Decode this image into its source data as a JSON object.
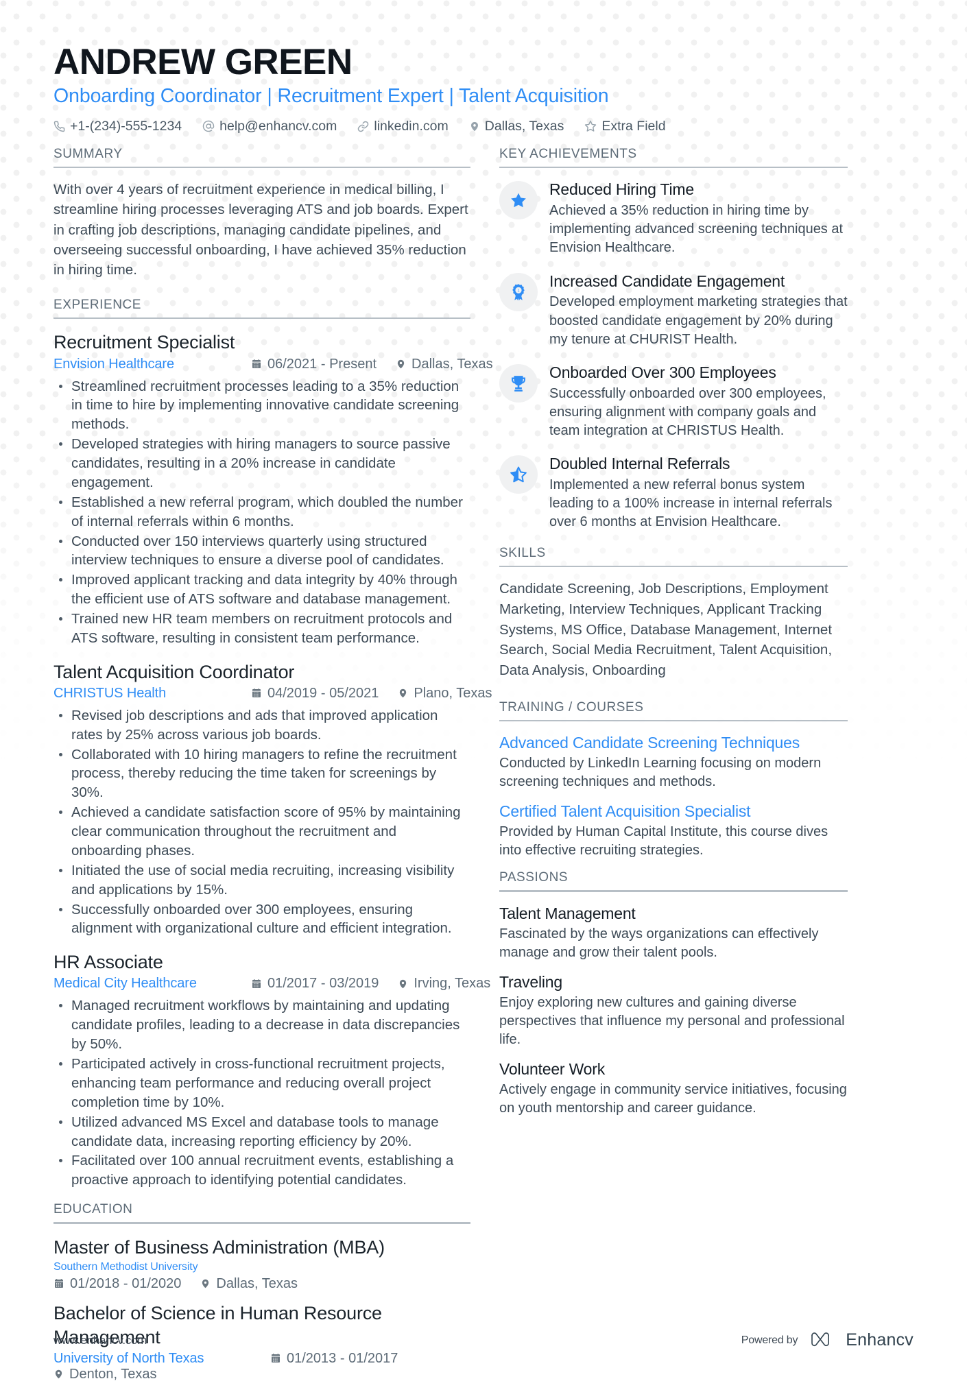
{
  "theme": {
    "accent": "#2f8df5",
    "text": "#3d4a56",
    "heading": "#141c24",
    "rule": "#b7bfc6",
    "icon_chip_bg": "#f0f1f2"
  },
  "header": {
    "name": "ANDREW GREEN",
    "headline": "Onboarding Coordinator | Recruitment Expert | Talent Acquisition",
    "contacts": [
      {
        "icon": "phone-icon",
        "label": "+1-(234)-555-1234"
      },
      {
        "icon": "at-sign-icon",
        "label": "help@enhancv.com"
      },
      {
        "icon": "link-icon",
        "label": "linkedin.com"
      },
      {
        "icon": "map-pin-icon",
        "label": "Dallas, Texas"
      },
      {
        "icon": "star-outline-icon",
        "label": "Extra Field"
      }
    ]
  },
  "left": {
    "summary": {
      "title": "SUMMARY",
      "text": "With over 4 years of recruitment experience in medical billing, I streamline hiring processes leveraging ATS and job boards. Expert in crafting job descriptions, managing candidate pipelines, and overseeing successful onboarding, I have achieved 35% reduction in hiring time."
    },
    "experience": {
      "title": "EXPERIENCE",
      "jobs": [
        {
          "title": "Recruitment Specialist",
          "company": "Envision Healthcare",
          "dates": "06/2021 - Present",
          "location": "Dallas, Texas",
          "bullets": [
            "Streamlined recruitment processes leading to a 35% reduction in time to hire by implementing innovative candidate screening methods.",
            "Developed strategies with hiring managers to source passive candidates, resulting in a 20% increase in candidate engagement.",
            "Established a new referral program, which doubled the number of internal referrals within 6 months.",
            "Conducted over 150 interviews quarterly using structured interview techniques to ensure a diverse pool of candidates.",
            "Improved applicant tracking and data integrity by 40% through the efficient use of ATS software and database management.",
            "Trained new HR team members on recruitment protocols and ATS software, resulting in consistent team performance."
          ]
        },
        {
          "title": "Talent Acquisition Coordinator",
          "company": "CHRISTUS Health",
          "dates": "04/2019 - 05/2021",
          "location": "Plano, Texas",
          "bullets": [
            "Revised job descriptions and ads that improved application rates by 25% across various job boards.",
            "Collaborated with 10 hiring managers to refine the recruitment process, thereby reducing the time taken for screenings by 30%.",
            "Achieved a candidate satisfaction score of 95% by maintaining clear communication throughout the recruitment and onboarding phases.",
            "Initiated the use of social media recruiting, increasing visibility and applications by 15%.",
            "Successfully onboarded over 300 employees, ensuring alignment with organizational culture and efficient integration."
          ]
        },
        {
          "title": "HR Associate",
          "company": "Medical City Healthcare",
          "dates": "01/2017 - 03/2019",
          "location": "Irving, Texas",
          "bullets": [
            "Managed recruitment workflows by maintaining and updating candidate profiles, leading to a decrease in data discrepancies by 50%.",
            "Participated actively in cross-functional recruitment projects, enhancing team performance and reducing overall project completion time by 10%.",
            "Utilized advanced MS Excel and database tools to manage candidate data, increasing reporting efficiency by 20%.",
            "Facilitated over 100 annual recruitment events, establishing a proactive approach to identifying potential candidates."
          ]
        }
      ]
    },
    "education": {
      "title": "EDUCATION",
      "entries": [
        {
          "degree": "Master of Business Administration (MBA)",
          "school": "Southern Methodist University",
          "dates": "01/2018 - 01/2020",
          "location": "Dallas, Texas",
          "layout": "stacked"
        },
        {
          "degree": "Bachelor of Science in Human Resource Management",
          "school": "University of North Texas",
          "dates": "01/2013 - 01/2017",
          "location": "Denton, Texas",
          "layout": "inline"
        }
      ]
    }
  },
  "right": {
    "key_achievements": {
      "title": "KEY ACHIEVEMENTS",
      "items": [
        {
          "icon": "star-filled-icon",
          "title": "Reduced Hiring Time",
          "desc": "Achieved a 35% reduction in hiring time by implementing advanced screening techniques at Envision Healthcare."
        },
        {
          "icon": "award-ribbon-icon",
          "title": "Increased Candidate Engagement",
          "desc": "Developed employment marketing strategies that boosted candidate engagement by 20% during my tenure at CHURIST Health."
        },
        {
          "icon": "trophy-icon",
          "title": "Onboarded Over 300 Employees",
          "desc": "Successfully onboarded over 300 employees, ensuring alignment with company goals and team integration at CHRISTUS Health."
        },
        {
          "icon": "star-half-icon",
          "title": "Doubled Internal Referrals",
          "desc": "Implemented a new referral bonus system leading to a 100% increase in internal referrals over 6 months at Envision Healthcare."
        }
      ]
    },
    "skills": {
      "title": "SKILLS",
      "text": "Candidate Screening, Job Descriptions, Employment Marketing, Interview Techniques, Applicant Tracking Systems, MS Office, Database Management, Internet Search, Social Media Recruitment, Talent Acquisition, Data Analysis, Onboarding"
    },
    "training": {
      "title": "TRAINING / COURSES",
      "courses": [
        {
          "title": "Advanced Candidate Screening Techniques",
          "desc": "Conducted by LinkedIn Learning focusing on modern screening techniques and methods."
        },
        {
          "title": "Certified Talent Acquisition Specialist",
          "desc": "Provided by Human Capital Institute, this course dives into effective recruiting strategies."
        }
      ]
    },
    "passions": {
      "title": "PASSIONS",
      "items": [
        {
          "title": "Talent Management",
          "desc": "Fascinated by the ways organizations can effectively manage and grow their talent pools."
        },
        {
          "title": "Traveling",
          "desc": "Enjoy exploring new cultures and gaining diverse perspectives that influence my personal and professional life."
        },
        {
          "title": "Volunteer Work",
          "desc": "Actively engage in community service initiatives, focusing on youth mentorship and career guidance."
        }
      ]
    }
  },
  "footer": {
    "url": "www.enhancv.com",
    "powered_by": "Powered by",
    "brand": "Enhancv"
  }
}
